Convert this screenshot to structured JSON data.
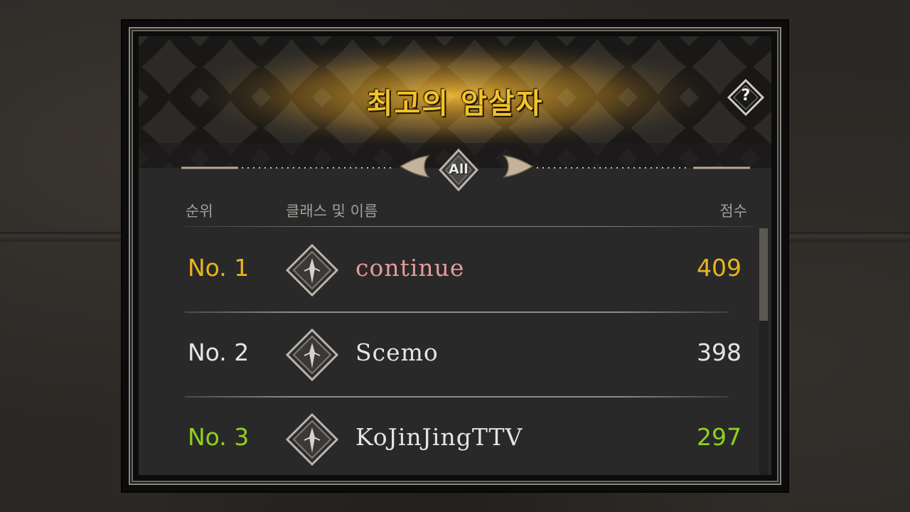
{
  "panel": {
    "title": "최고의 암살자",
    "help_label": "?",
    "filter_label": "All"
  },
  "columns": {
    "rank": "순위",
    "class_name": "클래스 및 이름",
    "score": "점수"
  },
  "leaderboard": [
    {
      "rank": "No. 1",
      "name": "continue",
      "score": "409",
      "class_icon": "assassin-class-icon",
      "rank_color": "#e8b51f",
      "name_color": "#e49a9a",
      "score_color": "#e8b51f"
    },
    {
      "rank": "No. 2",
      "name": "Scemo",
      "score": "398",
      "class_icon": "assassin-class-icon",
      "rank_color": "#e6e4e0",
      "name_color": "#e6e4e0",
      "score_color": "#e6e4e0"
    },
    {
      "rank": "No. 3",
      "name": "KoJinJingTTV",
      "score": "297",
      "class_icon": "assassin-class-icon",
      "rank_color": "#8fd21e",
      "name_color": "#e6e4e0",
      "score_color": "#8fd21e"
    }
  ],
  "colors": {
    "title": "#f2c22a",
    "gold": "#e8b51f",
    "green": "#8fd21e",
    "pink": "#e49a9a"
  }
}
